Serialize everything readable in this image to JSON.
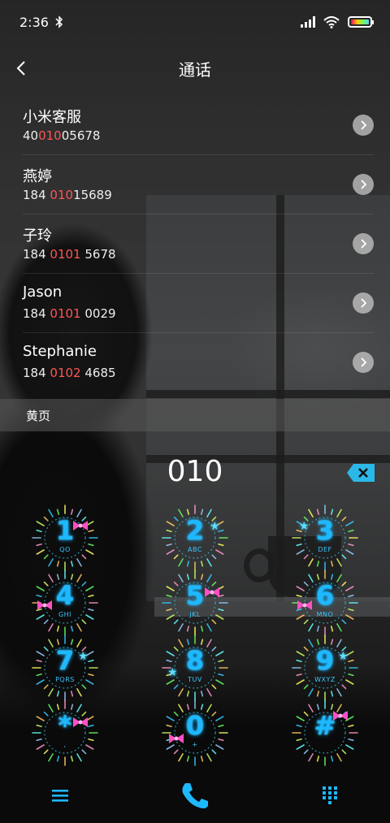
{
  "status_bar": {
    "time": "2:36"
  },
  "header": {
    "title": "通话"
  },
  "contacts": [
    {
      "name": "小米客服",
      "number_pre": "40",
      "number_match": "010",
      "number_post": "05678"
    },
    {
      "name": "燕婷",
      "number_pre": "184 ",
      "number_match": "010",
      "number_post": "15689"
    },
    {
      "name": "子玲",
      "number_pre": "184 ",
      "number_match": "0101",
      "number_post": " 5678"
    },
    {
      "name": "Jason",
      "number_pre": "184 ",
      "number_match": "0101",
      "number_post": " 0029"
    },
    {
      "name": "Stephanie",
      "number_pre": "184 ",
      "number_match": "0102",
      "number_post": " 4685"
    }
  ],
  "section": {
    "yellow_pages": "黄页"
  },
  "dial": {
    "input": "010"
  },
  "keypad": [
    {
      "digit": "1",
      "letters": "QO"
    },
    {
      "digit": "2",
      "letters": "ABC"
    },
    {
      "digit": "3",
      "letters": "DEF"
    },
    {
      "digit": "4",
      "letters": "GHI"
    },
    {
      "digit": "5",
      "letters": "JKL"
    },
    {
      "digit": "6",
      "letters": "MNO"
    },
    {
      "digit": "7",
      "letters": "PQRS"
    },
    {
      "digit": "8",
      "letters": "TUV"
    },
    {
      "digit": "9",
      "letters": "WXYZ"
    },
    {
      "digit": "*",
      "letters": ","
    },
    {
      "digit": "0",
      "letters": "+"
    },
    {
      "digit": "#",
      "letters": ""
    }
  ],
  "icons": {
    "back": "chevron-left-icon",
    "delete": "backspace-icon",
    "menu": "hamburger-menu-icon",
    "call": "phone-icon",
    "dialpad": "dialpad-icon",
    "bluetooth": "bluetooth-icon",
    "wifi": "wifi-icon",
    "signal": "signal-icon",
    "battery": "battery-icon"
  },
  "colors": {
    "accent": "#1eb8ff",
    "match_highlight": "#ff5555",
    "bow_pink": "#ff4fc3"
  }
}
